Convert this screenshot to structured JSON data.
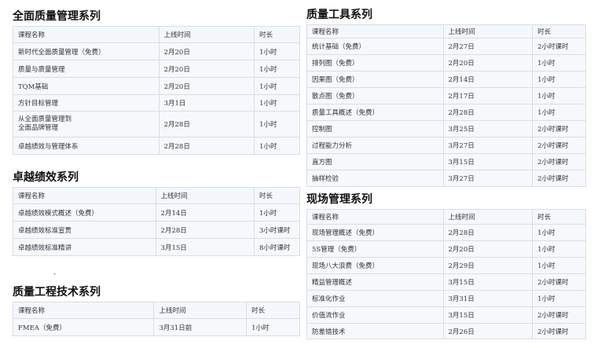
{
  "header": {
    "col_name": "课程名称",
    "col_date": "上线时间",
    "col_duration": "时长"
  },
  "sections": {
    "tqm": {
      "title": "全面质量管理系列",
      "rows": [
        {
          "name": "新时代全面质量管理（免费）",
          "date": "2月20日",
          "duration": "1小时"
        },
        {
          "name": "质量与质量管理",
          "date": "2月20日",
          "duration": "1小时"
        },
        {
          "name": "TQM基础",
          "date": "2月20日",
          "duration": "1小时"
        },
        {
          "name": "方针目标管理",
          "date": "3月1日",
          "duration": "1小时"
        },
        {
          "name": "从全面质量管理到\n全面品牌管理",
          "date": "2月28日",
          "duration": "1小时"
        },
        {
          "name": "卓越绩效与管理体系",
          "date": "2月28日",
          "duration": "1小时"
        }
      ]
    },
    "excellence": {
      "title": "卓越绩效系列",
      "rows": [
        {
          "name": "卓越绩效模式概述（免费）",
          "date": "2月14日",
          "duration": "1小时"
        },
        {
          "name": "卓越绩效标准宣贯",
          "date": "2月28日",
          "duration": "3小时课时"
        },
        {
          "name": "卓越绩效标准精讲",
          "date": "3月15日",
          "duration": "8小时课时"
        }
      ]
    },
    "engineering": {
      "title": "质量工程技术系列",
      "rows": [
        {
          "name": "FMEA（免费）",
          "date": "3月31日前",
          "duration": "1小时"
        }
      ]
    },
    "tools": {
      "title": "质量工具系列",
      "rows": [
        {
          "name": "统计基础（免费）",
          "date": "2月27日",
          "duration": "2小时课时"
        },
        {
          "name": "排列图（免费）",
          "date": "2月20日",
          "duration": "1小时"
        },
        {
          "name": "因果图（免费）",
          "date": "2月14日",
          "duration": "1小时"
        },
        {
          "name": "散点图（免费）",
          "date": "2月17日",
          "duration": "1小时"
        },
        {
          "name": "质量工具概述（免费）",
          "date": "2月28日",
          "duration": "1小时"
        },
        {
          "name": "控制图",
          "date": "3月25日",
          "duration": "2小时课时"
        },
        {
          "name": "过程能力分析",
          "date": "3月27日",
          "duration": "2小时课时"
        },
        {
          "name": "直方图",
          "date": "3月15日",
          "duration": "2小时课时"
        },
        {
          "name": "抽样检验",
          "date": "3月27日",
          "duration": "2小时课时"
        }
      ]
    },
    "onsite": {
      "title": "现场管理系列",
      "rows": [
        {
          "name": "现场管理概述（免费）",
          "date": "2月28日",
          "duration": "1小时"
        },
        {
          "name": "5S管理（免费）",
          "date": "2月20日",
          "duration": "1小时"
        },
        {
          "name": "现场八大浪费（免费）",
          "date": "2月29日",
          "duration": "1小时"
        },
        {
          "name": "精益管理概述",
          "date": "3月15日",
          "duration": "2小时课时"
        },
        {
          "name": "标准化作业",
          "date": "3月31日",
          "duration": "1小时"
        },
        {
          "name": "价值流作业",
          "date": "3月15日",
          "duration": "2小时课时"
        },
        {
          "name": "防差错技术",
          "date": "2月26日",
          "duration": "2小时课时"
        }
      ]
    }
  }
}
